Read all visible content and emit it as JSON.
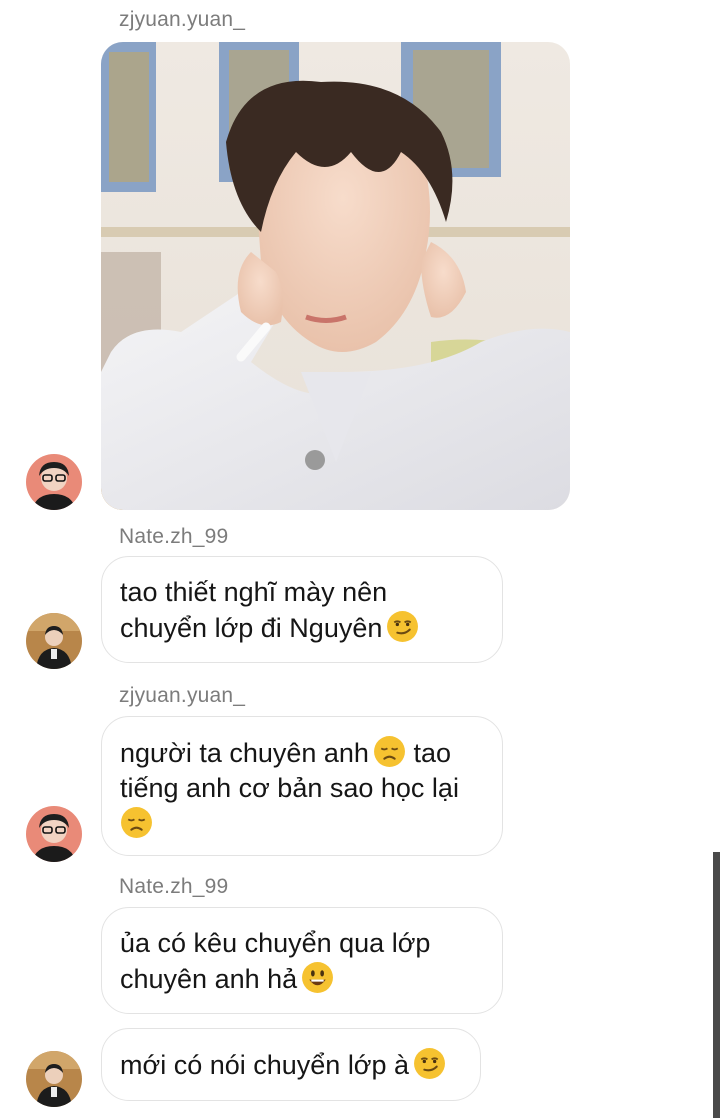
{
  "messages": [
    {
      "sender": "zjyuan.yuan_",
      "type": "photo"
    },
    {
      "sender": "Nate.zh_99",
      "lines": [
        "tao thiết nghĩ mày nên",
        "chuyển lớp đi Nguyên"
      ],
      "emoji": "smirk"
    },
    {
      "sender": "zjyuan.yuan_",
      "lines": [
        "người ta chuyên anh",
        "tiếng anh cơ bản sao học lại"
      ],
      "inline_emoji_after": "tao",
      "emoji": "disappointed"
    },
    {
      "sender": "Nate.zh_99",
      "lines": [
        "ủa có kêu chuyển qua lớp",
        "chuyên anh hả"
      ],
      "emoji": "smiley"
    },
    {
      "lines": [
        "mới có nói chuyển lớp à"
      ],
      "emoji": "smirk"
    }
  ],
  "colors": {
    "sender_text": "#7c7c7c",
    "bubble_border": "#e3e3e3",
    "emoji_yellow": "#f6c230",
    "scrollbar": "#4a4a4a"
  }
}
